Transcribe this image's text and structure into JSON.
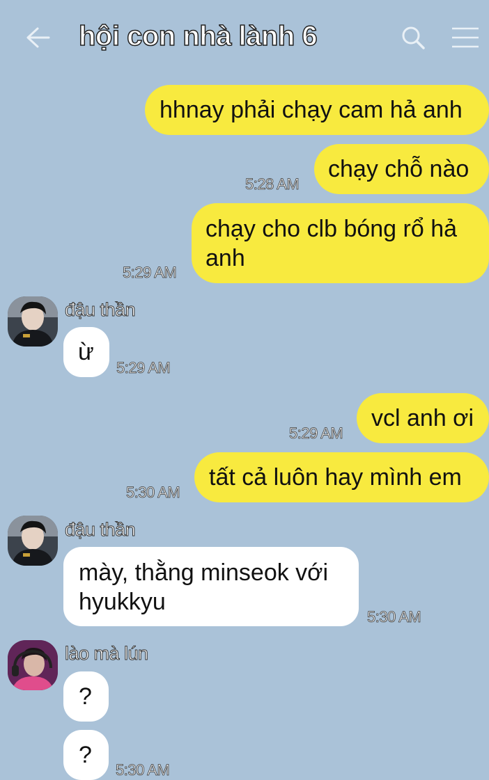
{
  "header": {
    "title": "hội con nhà lành 6",
    "back_icon": "arrow-left-icon",
    "search_icon": "search-icon",
    "menu_icon": "hamburger-menu-icon"
  },
  "colors": {
    "background": "#aac2d8",
    "my_bubble": "#f8ea3f",
    "their_bubble": "#ffffff"
  },
  "messages": [
    {
      "from": "me",
      "text": "hhnay phải chạy cam hả anh",
      "time": ""
    },
    {
      "from": "me",
      "text": "chạy chỗ nào",
      "time": "5:28 AM"
    },
    {
      "from": "me",
      "lines": [
        "chạy cho clb bóng rổ hả",
        "anh"
      ],
      "time": "5:29 AM"
    },
    {
      "from": "other",
      "sender": "đậu thần",
      "text": "ừ",
      "time": "5:29 AM"
    },
    {
      "from": "me",
      "text": "vcl anh ơi",
      "time": "5:29 AM"
    },
    {
      "from": "me",
      "text": "tất cả luôn hay mình em",
      "time": "5:30 AM"
    },
    {
      "from": "other",
      "sender": "đậu thần",
      "lines": [
        "mày, thằng minseok với",
        "hyukkyu"
      ],
      "time": "5:30 AM"
    },
    {
      "from": "other",
      "sender": "lào mà lún",
      "text": "?",
      "time": ""
    },
    {
      "from": "other",
      "text": "?",
      "time": "5:30 AM"
    }
  ]
}
